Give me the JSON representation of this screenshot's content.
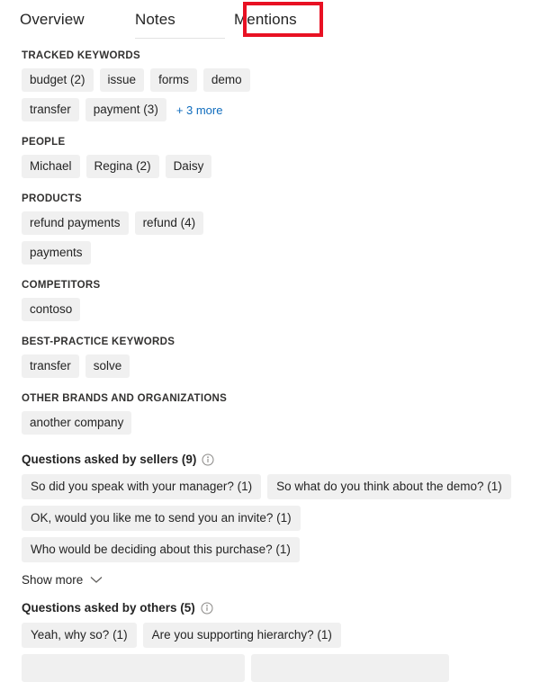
{
  "tabs": [
    {
      "label": "Overview",
      "selected": false
    },
    {
      "label": "Notes",
      "selected": false
    },
    {
      "label": "Mentions",
      "selected": true
    }
  ],
  "highlight_color": "#e81123",
  "link_color": "#0f6cbd",
  "chip_bg": "#f0f0f0",
  "sections": [
    {
      "title": "TRACKED KEYWORDS",
      "rows": [
        [
          "budget (2)",
          "issue",
          "forms",
          "demo"
        ],
        [
          "transfer",
          "payment (3)"
        ]
      ],
      "more_label": "+ 3 more"
    },
    {
      "title": "PEOPLE",
      "rows": [
        [
          "Michael",
          "Regina (2)",
          "Daisy"
        ]
      ]
    },
    {
      "title": "PRODUCTS",
      "rows": [
        [
          "refund payments",
          "refund (4)"
        ],
        [
          "payments"
        ]
      ]
    },
    {
      "title": "COMPETITORS",
      "rows": [
        [
          "contoso"
        ]
      ]
    },
    {
      "title": "BEST-PRACTICE KEYWORDS",
      "rows": [
        [
          "transfer",
          "solve"
        ]
      ]
    },
    {
      "title": "OTHER BRANDS AND ORGANIZATIONS",
      "rows": [
        [
          "another company"
        ]
      ]
    }
  ],
  "questions_sellers": {
    "title": "Questions asked by sellers (9)",
    "info_icon": "info-icon",
    "rows": [
      [
        "So did you speak with your manager? (1)",
        "So what do you think about the demo? (1)"
      ],
      [
        "OK, would you like me to send you an invite? (1)",
        "Who would be deciding about this purchase? (1)"
      ]
    ],
    "show_more_label": "Show more",
    "show_more_icon": "chevron-down-icon"
  },
  "questions_others": {
    "title": "Questions asked by others (5)",
    "info_icon": "info-icon",
    "rows": [
      [
        "Yeah, why so? (1)",
        "Are you supporting hierarchy? (1)"
      ],
      [
        "",
        ""
      ]
    ]
  }
}
